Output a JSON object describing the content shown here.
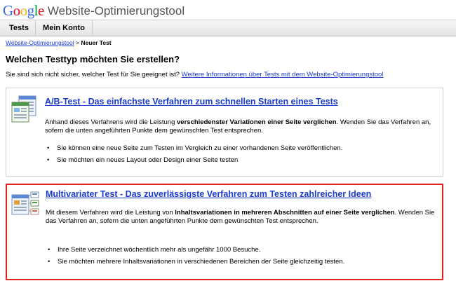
{
  "header": {
    "logo_text": "Google",
    "product_name": "Website-Optimierungstool"
  },
  "tabs": [
    {
      "label": "Tests"
    },
    {
      "label": "Mein Konto"
    }
  ],
  "breadcrumb": {
    "link": "Website-Optimierungstool",
    "separator": " > ",
    "current": "Neuer Test"
  },
  "page_title": "Welchen Testtyp möchten Sie erstellen?",
  "intro": {
    "text": "Sie sind sich nicht sicher, welcher Test für Sie geeignet ist? ",
    "link": "Weitere Informationen über Tests mit dem Website-Optimierungstool"
  },
  "ab_test": {
    "title": "A/B-Test - Das einfachste Verfahren zum schnellen Starten eines Tests",
    "desc_pre": "Anhand dieses Verfahrens wird die Leistung ",
    "desc_bold": "verschiedenster Variationen einer Seite verglichen",
    "desc_post": ". Wenden Sie das Verfahren an, sofern die unten angeführten Punkte dem gewünschten Test entsprechen.",
    "bullets": [
      "Sie können eine neue Seite zum Testen im Vergleich zu einer vorhandenen Seite veröffentlichen.",
      "Sie möchten ein neues Layout oder Design einer Seite testen"
    ]
  },
  "mv_test": {
    "title": "Multivariater Test - Das zuverlässigste Verfahren zum Testen zahlreicher Ideen",
    "desc_pre": "Mit diesem Verfahren wird die Leistung von ",
    "desc_bold": "Inhaltsvariationen in mehreren Abschnitten auf einer Seite verglichen",
    "desc_post": ". Wenden Sie das Verfahren an, sofern die unten angeführten Punkte dem gewünschten Test entsprechen.",
    "bullets": [
      "Ihre Seite verzeichnet wöchentlich mehr als ungefähr 1000 Besuche.",
      "Sie möchten mehrere Inhaltsvariationen in verschiedenen Bereichen der Seite gleichzeitig testen."
    ]
  },
  "colors": {
    "link": "#1a3ccc",
    "highlight_border": "#e32222"
  }
}
